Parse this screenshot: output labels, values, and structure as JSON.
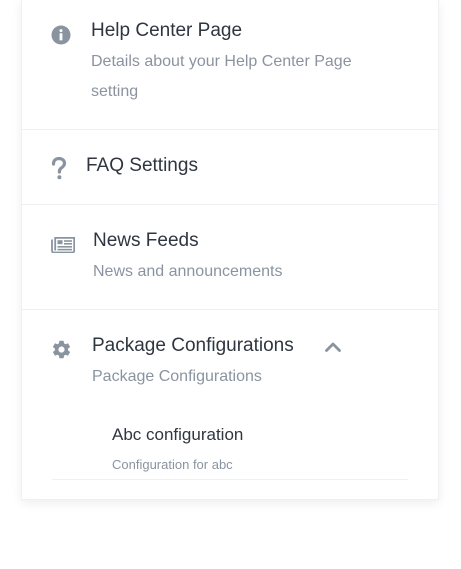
{
  "menu": {
    "items": [
      {
        "title": "Help Center Page",
        "description_line1": "Details about your Help Center Page",
        "description_line2": "setting",
        "icon": "info-circle-icon"
      },
      {
        "title": "FAQ Settings",
        "icon": "question-mark-icon"
      },
      {
        "title": "News Feeds",
        "description": "News and announcements",
        "icon": "newspaper-icon"
      },
      {
        "title": "Package Configurations",
        "description": "Package Configurations",
        "icon": "gear-icon",
        "expanded": true,
        "children": [
          {
            "title": "Abc configuration",
            "description": "Configuration for abc"
          }
        ]
      }
    ]
  },
  "colors": {
    "icon": "#8a94a0",
    "title": "#2f3640",
    "subtitle": "#8a94a0",
    "divider": "#eef0f3"
  }
}
